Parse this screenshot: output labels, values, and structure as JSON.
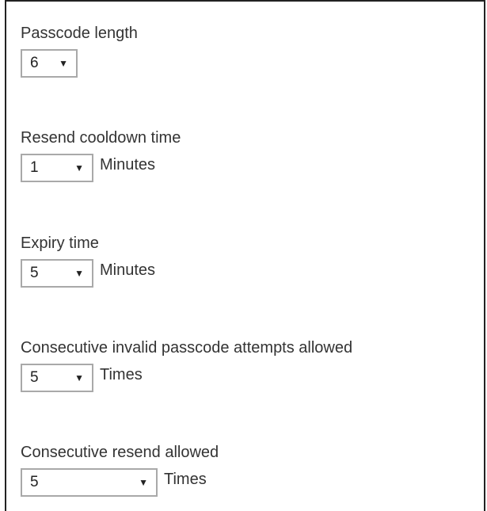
{
  "settings": [
    {
      "label": "Passcode length",
      "value": "6",
      "unit": ""
    },
    {
      "label": "Resend cooldown time",
      "value": "1",
      "unit": "Minutes"
    },
    {
      "label": "Expiry time",
      "value": "5",
      "unit": "Minutes"
    },
    {
      "label": "Consecutive invalid passcode attempts allowed",
      "value": "5",
      "unit": "Times"
    },
    {
      "label": "Consecutive resend allowed",
      "value": "5",
      "unit": "Times"
    }
  ],
  "icons": {
    "dropdown": "chevron-down-icon",
    "glyph": "▼"
  },
  "colors": {
    "border": "#a9a9a9",
    "text": "#333333",
    "panel_border": "#222222"
  }
}
